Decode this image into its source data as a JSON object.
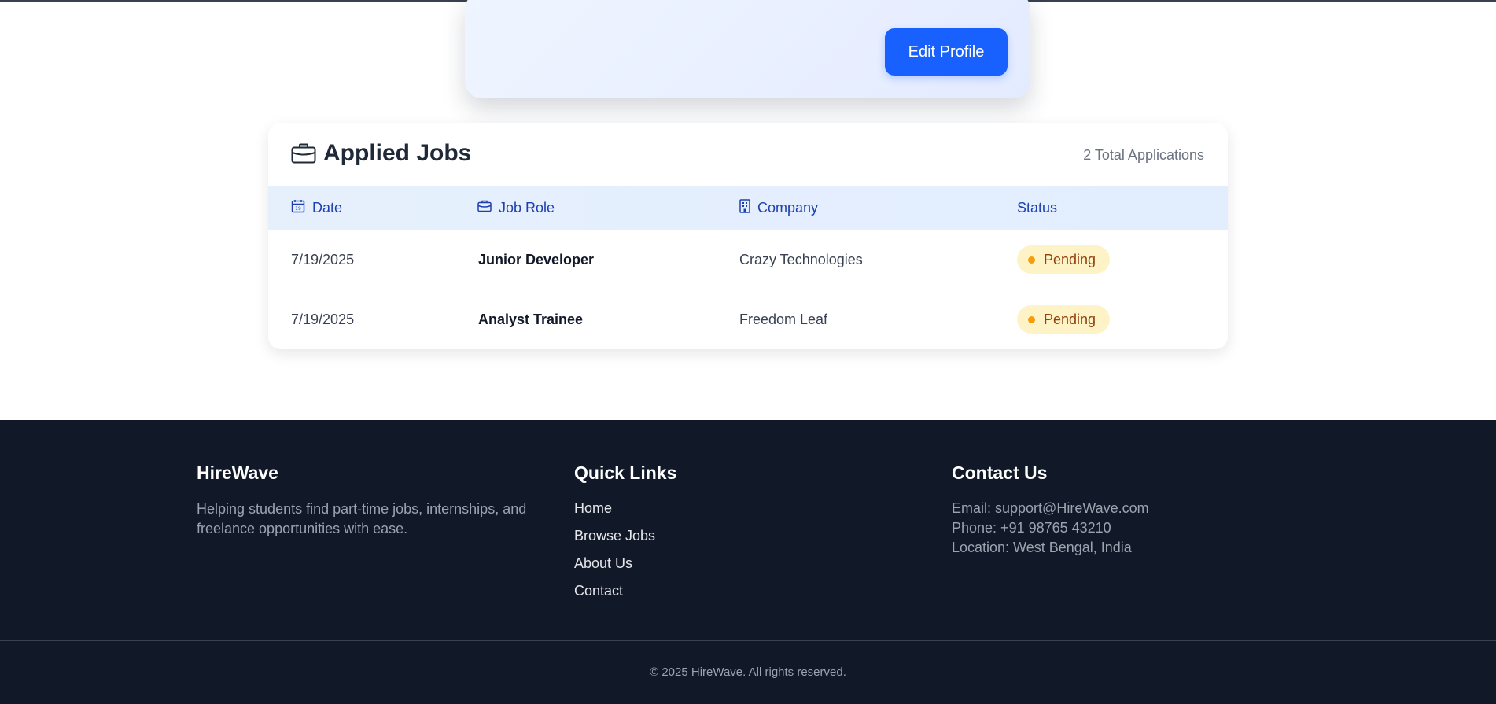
{
  "profile": {
    "edit_button": "Edit Profile"
  },
  "jobs": {
    "title": "Applied Jobs",
    "count_label": "2 Total Applications",
    "columns": {
      "date": "Date",
      "role": "Job Role",
      "company": "Company",
      "status": "Status"
    },
    "rows": [
      {
        "date": "7/19/2025",
        "role": "Junior Developer",
        "company": "Crazy Technologies",
        "status": "Pending"
      },
      {
        "date": "7/19/2025",
        "role": "Analyst Trainee",
        "company": "Freedom Leaf",
        "status": "Pending"
      }
    ]
  },
  "footer": {
    "brand": {
      "name": "HireWave",
      "tagline": "Helping students find part-time jobs, internships, and freelance opportunities with ease."
    },
    "quick_links": {
      "heading": "Quick Links",
      "items": [
        "Home",
        "Browse Jobs",
        "About Us",
        "Contact"
      ]
    },
    "contact": {
      "heading": "Contact Us",
      "email": "Email: support@HireWave.com",
      "phone": "Phone: +91 98765 43210",
      "location": "Location: West Bengal, India"
    },
    "copyright": "© 2025 HireWave. All rights reserved."
  },
  "colors": {
    "primary": "#1961ff",
    "footer_bg": "#111827",
    "status_pending_bg": "#fef3c7",
    "status_pending_text": "#92400e",
    "table_header_text": "#1e40af"
  },
  "icons": {
    "title": "briefcase-icon",
    "date": "calendar-icon",
    "role": "briefcase-icon",
    "company": "building-icon",
    "status_dot": "dot-icon"
  }
}
